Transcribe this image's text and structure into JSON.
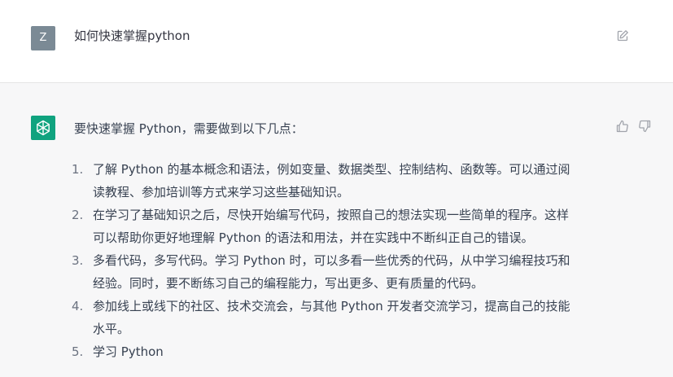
{
  "user_message": {
    "avatar_letter": "Z",
    "text": "如何快速掌握python",
    "edit_icon": "edit-icon"
  },
  "assistant_message": {
    "avatar_icon": "openai-logo-icon",
    "intro": "要快速掌握 Python，需要做到以下几点：",
    "feedback_icons": [
      "thumbs-up-icon",
      "thumbs-down-icon"
    ],
    "items": [
      {
        "number": "1.",
        "lines": [
          "了解 Python 的基本概念和语法，例如变量、数据类型、控制结构、函数等。可以通过阅",
          "读教程、参加培训等方式来学习这些基础知识。"
        ]
      },
      {
        "number": "2.",
        "lines": [
          "在学习了基础知识之后，尽快开始编写代码，按照自己的想法实现一些简单的程序。这样",
          "可以帮助你更好地理解 Python 的语法和用法，并在实践中不断纠正自己的错误。"
        ]
      },
      {
        "number": "3.",
        "lines": [
          "多看代码，多写代码。学习 Python 时，可以多看一些优秀的代码，从中学习编程技巧和",
          "经验。同时，要不断练习自己的编程能力，写出更多、更有质量的代码。"
        ]
      },
      {
        "number": "4.",
        "lines": [
          "参加线上或线下的社区、技术交流会，与其他 Python 开发者交流学习，提高自己的技能",
          "水平。"
        ]
      },
      {
        "number": "5.",
        "lines": [
          "学习 Python"
        ]
      }
    ]
  },
  "colors": {
    "user_avatar_bg": "#7b8a95",
    "assistant_avatar_bg": "#10a37f",
    "assistant_row_bg": "#f7f7f8"
  }
}
